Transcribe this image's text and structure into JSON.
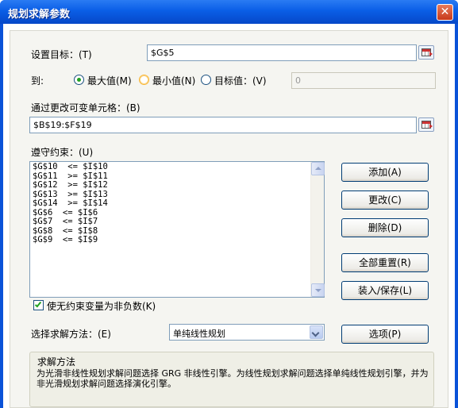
{
  "window": {
    "title": "规划求解参数",
    "close_glyph": "✕"
  },
  "objective": {
    "label": "设置目标：(T)",
    "value": "$G$5"
  },
  "to": {
    "label": "到:",
    "options": [
      {
        "label": "最大值(M)",
        "checked": true
      },
      {
        "label": "最小值(N)",
        "checked": false
      },
      {
        "label": "目标值：(V)",
        "checked": false
      }
    ],
    "target_value": "0"
  },
  "variables": {
    "label": "通过更改可变单元格：(B)",
    "value": "$B$19:$F$19"
  },
  "constraints": {
    "label": "遵守约束：(U)",
    "items": [
      "$G$10  <= $I$10",
      "$G$11  >= $I$11",
      "$G$12  >= $I$12",
      "$G$13  >= $I$13",
      "$G$14  >= $I$14",
      "$G$6  <= $I$6",
      "$G$7  <= $I$7",
      "$G$8  <= $I$8",
      "$G$9  <= $I$9"
    ]
  },
  "buttons": {
    "add": "添加(A)",
    "change": "更改(C)",
    "delete": "删除(D)",
    "reset_all": "全部重置(R)",
    "load_save": "装入/保存(L)",
    "options": "选项(P)"
  },
  "nonneg": {
    "label": "使无约束变量为非负数(K)",
    "checked": true
  },
  "method": {
    "label": "选择求解方法：(E)",
    "value": "单纯线性规划"
  },
  "solving": {
    "title": "求解方法",
    "description": "为光滑非线性规划求解问题选择 GRG 非线性引擎。为线性规划求解问题选择单纯线性规划引擎，并为非光滑规划求解问题选择演化引擎。"
  },
  "icons": {
    "ref": "range-select-icon"
  }
}
